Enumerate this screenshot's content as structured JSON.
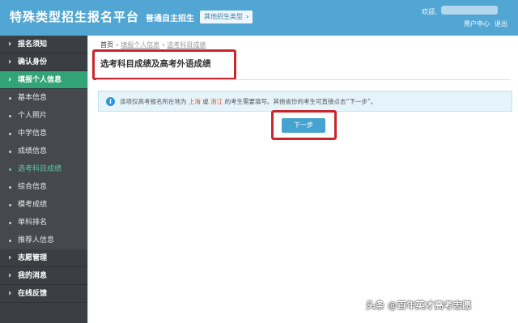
{
  "header": {
    "brand": "特殊类型招生报名平台",
    "subtitle": "普通自主招生",
    "switch_label": "其他招生类型",
    "welcome": "欢迎,",
    "user_center": "用户中心",
    "logout": "退出"
  },
  "sidebar": {
    "top_items": [
      {
        "label": "报名须知"
      },
      {
        "label": "确认身份"
      },
      {
        "label": "填报个人信息"
      }
    ],
    "sub_items": [
      {
        "label": "基本信息"
      },
      {
        "label": "个人照片"
      },
      {
        "label": "中学信息"
      },
      {
        "label": "成绩信息"
      },
      {
        "label": "选考科目成绩"
      },
      {
        "label": "综合信息"
      },
      {
        "label": "模考成绩"
      },
      {
        "label": "单科排名"
      },
      {
        "label": "推荐人信息"
      }
    ],
    "bottom_items": [
      {
        "label": "志愿管理"
      },
      {
        "label": "我的消息"
      },
      {
        "label": "在线反馈"
      }
    ]
  },
  "main": {
    "breadcrumb": [
      "首页",
      "填报个人信息",
      "选考科目成绩"
    ],
    "title": "选考科目成绩及高考外语成绩",
    "info": {
      "before": "该项仅高考报名所在地为",
      "region1": "上海",
      "or": "或",
      "region2": "浙江",
      "after": "的考生需要填写。其他省份的考生可直接点击“下一步”。"
    },
    "next_button": "下一步"
  },
  "watermark": "头条 @百年英才高考志愿",
  "colors": {
    "header_bg": "#52a6d3",
    "sidebar_bg": "#3b3f44",
    "active_bg": "#33a478",
    "highlight_box": "#c9262c",
    "button_bg": "#46a3d1"
  }
}
